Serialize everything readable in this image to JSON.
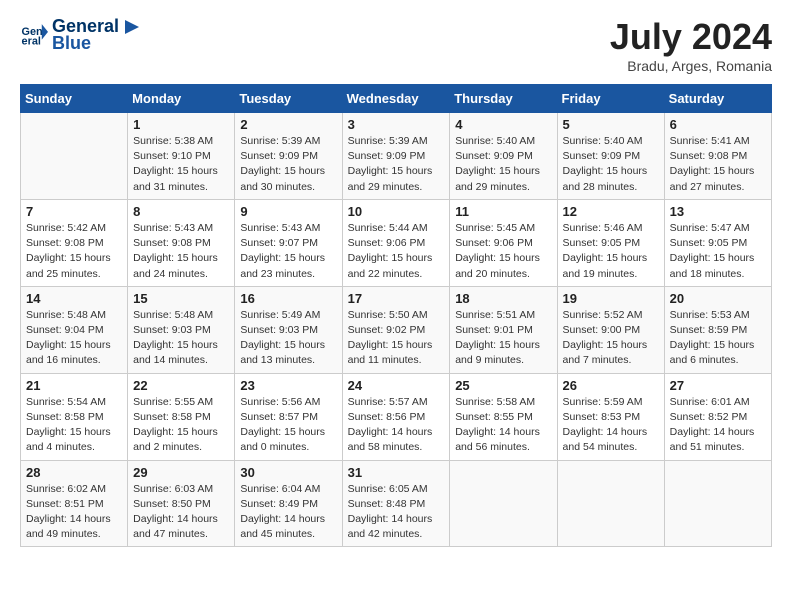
{
  "header": {
    "logo_line1": "General",
    "logo_line2": "Blue",
    "month": "July 2024",
    "location": "Bradu, Arges, Romania"
  },
  "weekdays": [
    "Sunday",
    "Monday",
    "Tuesday",
    "Wednesday",
    "Thursday",
    "Friday",
    "Saturday"
  ],
  "weeks": [
    [
      {
        "day": "",
        "info": ""
      },
      {
        "day": "1",
        "info": "Sunrise: 5:38 AM\nSunset: 9:10 PM\nDaylight: 15 hours\nand 31 minutes."
      },
      {
        "day": "2",
        "info": "Sunrise: 5:39 AM\nSunset: 9:09 PM\nDaylight: 15 hours\nand 30 minutes."
      },
      {
        "day": "3",
        "info": "Sunrise: 5:39 AM\nSunset: 9:09 PM\nDaylight: 15 hours\nand 29 minutes."
      },
      {
        "day": "4",
        "info": "Sunrise: 5:40 AM\nSunset: 9:09 PM\nDaylight: 15 hours\nand 29 minutes."
      },
      {
        "day": "5",
        "info": "Sunrise: 5:40 AM\nSunset: 9:09 PM\nDaylight: 15 hours\nand 28 minutes."
      },
      {
        "day": "6",
        "info": "Sunrise: 5:41 AM\nSunset: 9:08 PM\nDaylight: 15 hours\nand 27 minutes."
      }
    ],
    [
      {
        "day": "7",
        "info": "Sunrise: 5:42 AM\nSunset: 9:08 PM\nDaylight: 15 hours\nand 25 minutes."
      },
      {
        "day": "8",
        "info": "Sunrise: 5:43 AM\nSunset: 9:08 PM\nDaylight: 15 hours\nand 24 minutes."
      },
      {
        "day": "9",
        "info": "Sunrise: 5:43 AM\nSunset: 9:07 PM\nDaylight: 15 hours\nand 23 minutes."
      },
      {
        "day": "10",
        "info": "Sunrise: 5:44 AM\nSunset: 9:06 PM\nDaylight: 15 hours\nand 22 minutes."
      },
      {
        "day": "11",
        "info": "Sunrise: 5:45 AM\nSunset: 9:06 PM\nDaylight: 15 hours\nand 20 minutes."
      },
      {
        "day": "12",
        "info": "Sunrise: 5:46 AM\nSunset: 9:05 PM\nDaylight: 15 hours\nand 19 minutes."
      },
      {
        "day": "13",
        "info": "Sunrise: 5:47 AM\nSunset: 9:05 PM\nDaylight: 15 hours\nand 18 minutes."
      }
    ],
    [
      {
        "day": "14",
        "info": "Sunrise: 5:48 AM\nSunset: 9:04 PM\nDaylight: 15 hours\nand 16 minutes."
      },
      {
        "day": "15",
        "info": "Sunrise: 5:48 AM\nSunset: 9:03 PM\nDaylight: 15 hours\nand 14 minutes."
      },
      {
        "day": "16",
        "info": "Sunrise: 5:49 AM\nSunset: 9:03 PM\nDaylight: 15 hours\nand 13 minutes."
      },
      {
        "day": "17",
        "info": "Sunrise: 5:50 AM\nSunset: 9:02 PM\nDaylight: 15 hours\nand 11 minutes."
      },
      {
        "day": "18",
        "info": "Sunrise: 5:51 AM\nSunset: 9:01 PM\nDaylight: 15 hours\nand 9 minutes."
      },
      {
        "day": "19",
        "info": "Sunrise: 5:52 AM\nSunset: 9:00 PM\nDaylight: 15 hours\nand 7 minutes."
      },
      {
        "day": "20",
        "info": "Sunrise: 5:53 AM\nSunset: 8:59 PM\nDaylight: 15 hours\nand 6 minutes."
      }
    ],
    [
      {
        "day": "21",
        "info": "Sunrise: 5:54 AM\nSunset: 8:58 PM\nDaylight: 15 hours\nand 4 minutes."
      },
      {
        "day": "22",
        "info": "Sunrise: 5:55 AM\nSunset: 8:58 PM\nDaylight: 15 hours\nand 2 minutes."
      },
      {
        "day": "23",
        "info": "Sunrise: 5:56 AM\nSunset: 8:57 PM\nDaylight: 15 hours\nand 0 minutes."
      },
      {
        "day": "24",
        "info": "Sunrise: 5:57 AM\nSunset: 8:56 PM\nDaylight: 14 hours\nand 58 minutes."
      },
      {
        "day": "25",
        "info": "Sunrise: 5:58 AM\nSunset: 8:55 PM\nDaylight: 14 hours\nand 56 minutes."
      },
      {
        "day": "26",
        "info": "Sunrise: 5:59 AM\nSunset: 8:53 PM\nDaylight: 14 hours\nand 54 minutes."
      },
      {
        "day": "27",
        "info": "Sunrise: 6:01 AM\nSunset: 8:52 PM\nDaylight: 14 hours\nand 51 minutes."
      }
    ],
    [
      {
        "day": "28",
        "info": "Sunrise: 6:02 AM\nSunset: 8:51 PM\nDaylight: 14 hours\nand 49 minutes."
      },
      {
        "day": "29",
        "info": "Sunrise: 6:03 AM\nSunset: 8:50 PM\nDaylight: 14 hours\nand 47 minutes."
      },
      {
        "day": "30",
        "info": "Sunrise: 6:04 AM\nSunset: 8:49 PM\nDaylight: 14 hours\nand 45 minutes."
      },
      {
        "day": "31",
        "info": "Sunrise: 6:05 AM\nSunset: 8:48 PM\nDaylight: 14 hours\nand 42 minutes."
      },
      {
        "day": "",
        "info": ""
      },
      {
        "day": "",
        "info": ""
      },
      {
        "day": "",
        "info": ""
      }
    ]
  ]
}
